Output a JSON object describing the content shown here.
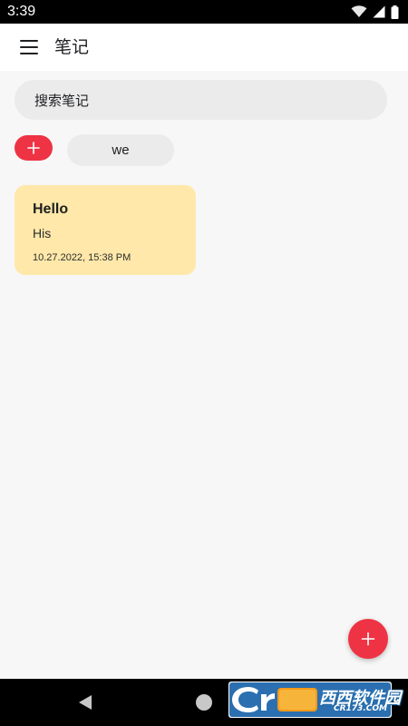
{
  "status_bar": {
    "time": "3:39",
    "icons": [
      "wifi-icon",
      "signal-icon",
      "battery-icon"
    ]
  },
  "app_bar": {
    "menu_icon": "menu-icon",
    "title": "笔记"
  },
  "search": {
    "placeholder": "搜索笔记"
  },
  "tags": {
    "add_icon": "plus-icon",
    "items": [
      {
        "label": "we"
      }
    ]
  },
  "notes": [
    {
      "title": "Hello",
      "body": "His",
      "date": "10.27.2022, 15:38 PM",
      "color": "#ffe8a9"
    }
  ],
  "fab": {
    "icon": "plus-icon"
  },
  "nav_bar": {
    "icons": [
      "back-icon",
      "home-icon"
    ]
  },
  "watermark": {
    "brand_chinese": "西西软件园",
    "brand_english": "CR173.COM"
  },
  "colors": {
    "accent": "#ee3344",
    "note_yellow": "#ffe8a9",
    "surface": "#ebebeb",
    "background": "#f7f7f7"
  }
}
